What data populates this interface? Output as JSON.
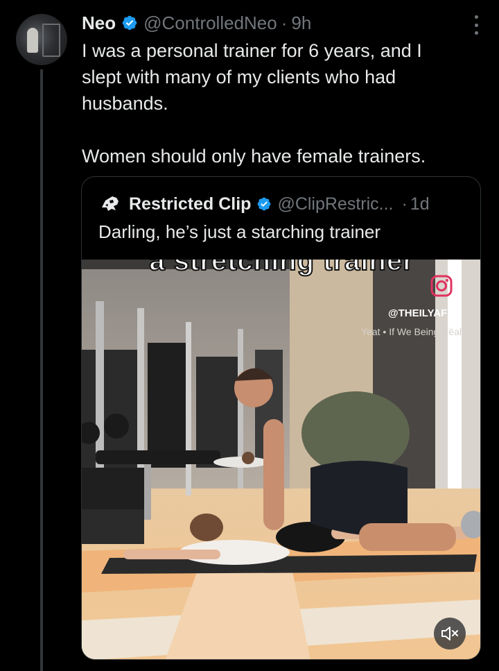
{
  "tweet": {
    "display_name": "Neo",
    "handle": "@ControlledNeo",
    "separator": "·",
    "time": "9h",
    "text": "I was a personal trainer for 6 years, and I\nslept with many of my clients who had\nhusbands.\n\nWomen should only have female trainers."
  },
  "quote": {
    "display_name": "Restricted Clip",
    "handle": "@ClipRestric...",
    "separator": "·",
    "time": "1d",
    "text": "Darling, he’s just a starching trainer",
    "video": {
      "caption": "a stretching trainer",
      "watermark_handle": "@THEILYAFIT",
      "watermark_music": "Yeat • If We Being Rëal"
    }
  },
  "colors": {
    "background": "#000000",
    "text_primary": "#e7e9ea",
    "text_secondary": "#71767b",
    "verified_blue": "#1d9bf0",
    "border": "#2f3336"
  },
  "icons": {
    "verified": "verified-badge-icon",
    "more": "more-options-icon",
    "instagram": "instagram-icon",
    "mute": "volume-muted-icon"
  }
}
